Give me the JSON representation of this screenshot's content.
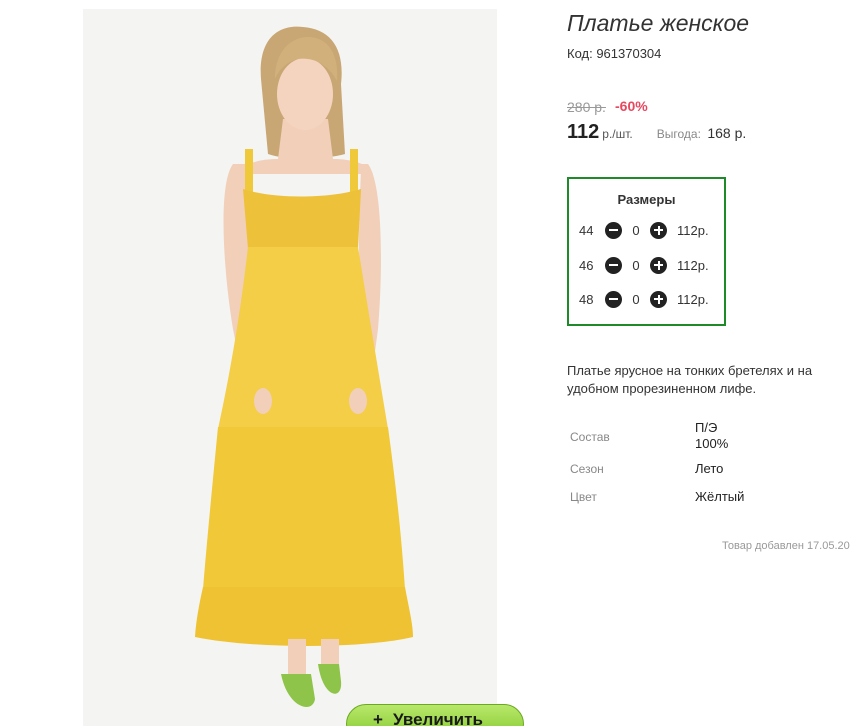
{
  "product": {
    "title": "Платье женское",
    "code": "Код: 961370304",
    "old_price": "280 р.",
    "discount": "-60%",
    "price": "112",
    "price_unit": "р./шт.",
    "benefit_label": "Выгода:",
    "benefit_value": "168 р."
  },
  "sizes": {
    "title": "Размеры",
    "items": [
      {
        "size": "44",
        "qty": "0",
        "price": "112р."
      },
      {
        "size": "46",
        "qty": "0",
        "price": "112р."
      },
      {
        "size": "48",
        "qty": "0",
        "price": "112р."
      }
    ]
  },
  "description": "Платье ярусное на тонких бретелях и на удобном прорезиненном лифе.",
  "properties": [
    {
      "label": "Состав",
      "value_1": "П/Э",
      "value_2": "100%"
    },
    {
      "label": "Сезон",
      "value_1": "Лето"
    },
    {
      "label": "Цвет",
      "value_1": "Жёлтый"
    }
  ],
  "added": "Товар добавлен 17.05.20",
  "zoom_button": {
    "icon": "+",
    "label": "Увеличить"
  },
  "colors": {
    "discount": "#e8475f",
    "sizes_border": "#1e8a2a",
    "zoom_button": "#9ad84a",
    "dress": "#f0c93a"
  }
}
